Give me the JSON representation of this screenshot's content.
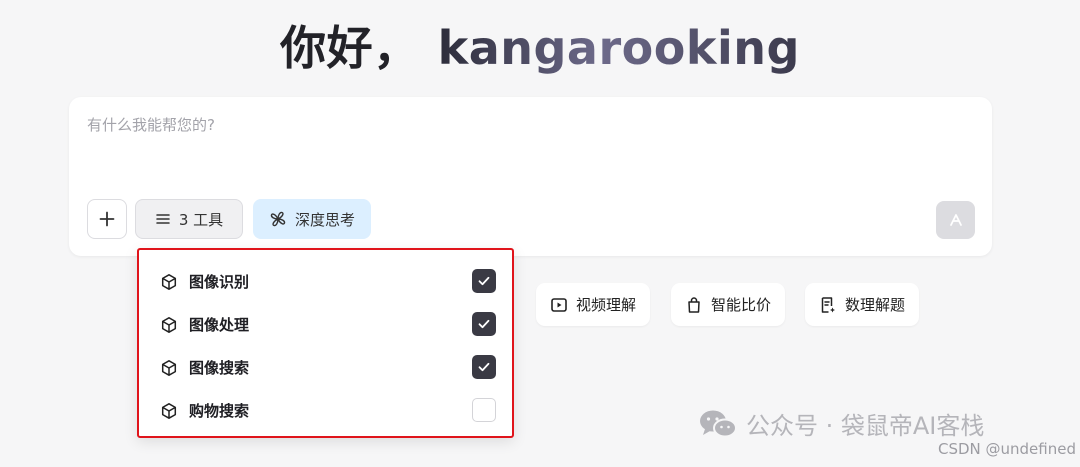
{
  "greeting": {
    "hello": "你好，",
    "username": "kangarooking"
  },
  "composer": {
    "placeholder": "有什么我能帮您的?",
    "plus_label": "+",
    "tools_label": "3 工具",
    "deep_think_label": "深度思考"
  },
  "chips": [
    {
      "label": "视频理解",
      "icon": "video-icon"
    },
    {
      "label": "智能比价",
      "icon": "shopping-bag-icon"
    },
    {
      "label": "数理解题",
      "icon": "document-sparkle-icon"
    }
  ],
  "tools_menu": {
    "items": [
      {
        "label": "图像识别",
        "icon": "cube-icon",
        "checked": true
      },
      {
        "label": "图像处理",
        "icon": "cube-icon",
        "checked": true
      },
      {
        "label": "图像搜索",
        "icon": "cube-icon",
        "checked": true
      },
      {
        "label": "购物搜索",
        "icon": "cube-icon",
        "checked": false
      }
    ]
  },
  "watermark": {
    "text": "公众号 · 袋鼠帝AI客栈",
    "source": "CSDN @undefined"
  },
  "colors": {
    "background": "#f6f6f7",
    "deep_think_bg": "#dcefff",
    "checkbox_checked": "#3a3a44",
    "highlight_border": "#e0141b"
  }
}
